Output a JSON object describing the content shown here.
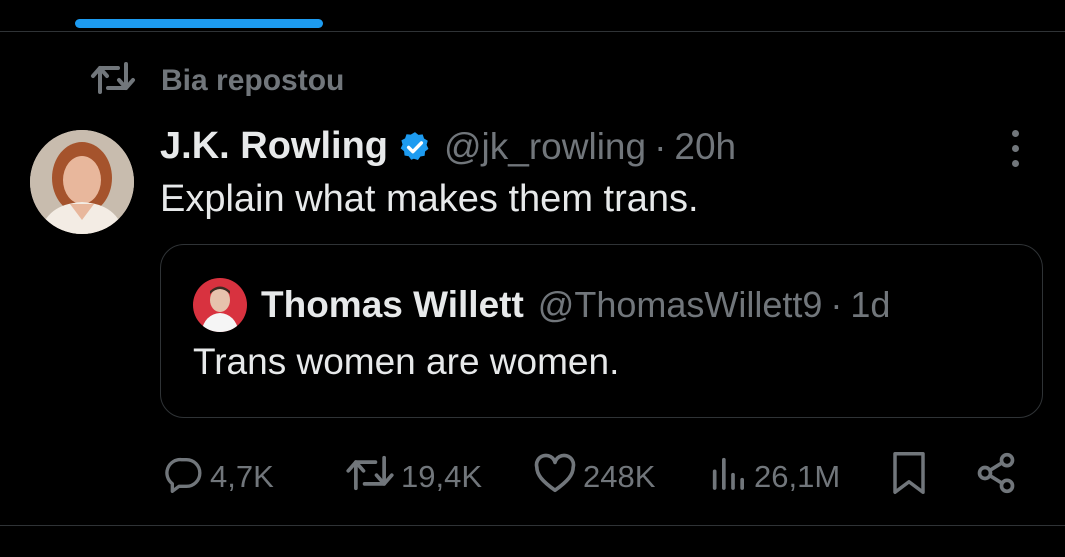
{
  "repost": {
    "label": "Bia repostou",
    "icon": "repost-icon"
  },
  "tweet": {
    "author": "J.K. Rowling",
    "handle": "@jk_rowling",
    "separator": "·",
    "time": "20h",
    "text": "Explain what makes them trans."
  },
  "quote": {
    "author": "Thomas Willett",
    "handle": "@ThomasWillett9",
    "separator": "·",
    "time": "1d",
    "text": "Trans women are women."
  },
  "actions": {
    "replies": "4,7K",
    "reposts": "19,4K",
    "likes": "248K",
    "views": "26,1M"
  },
  "colors": {
    "background": "#000000",
    "text": "#e7e9ea",
    "muted": "#71767b",
    "accent": "#1d9bf0",
    "border": "#2f3336"
  }
}
